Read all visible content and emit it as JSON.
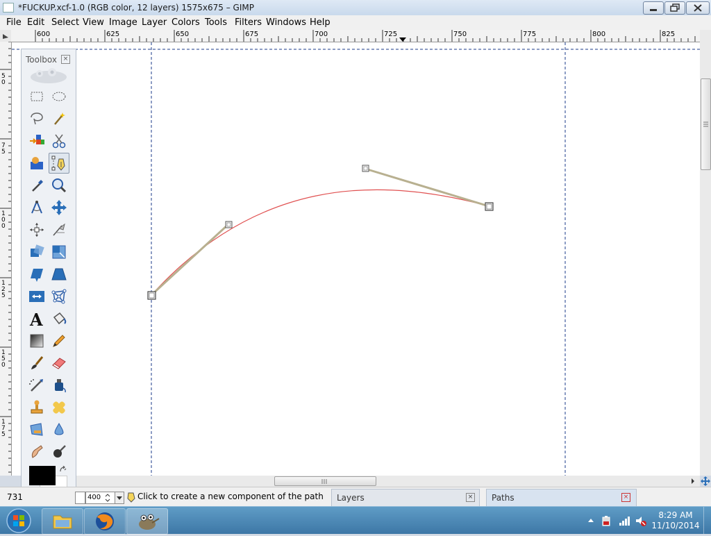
{
  "window": {
    "title": "*FUCKUP.xcf-1.0 (RGB color, 12 layers) 1575x675 – GIMP"
  },
  "menu": [
    "File",
    "Edit",
    "Select",
    "View",
    "Image",
    "Layer",
    "Colors",
    "Tools",
    "Filters",
    "Windows",
    "Help"
  ],
  "ruler": {
    "h_labels": [
      "600",
      "625",
      "650",
      "675",
      "700",
      "725",
      "750",
      "775",
      "800",
      "825"
    ],
    "v_labels": [
      "50",
      "75",
      "100",
      "125",
      "150",
      "175"
    ]
  },
  "toolbox": {
    "title": "Toolbox",
    "tools": [
      "rect-select",
      "ellipse-select",
      "free-select",
      "fuzzy-select",
      "select-by-color",
      "scissors-select",
      "foreground-select",
      "paths",
      "color-picker",
      "zoom",
      "measure",
      "move",
      "align",
      "crop",
      "rotate",
      "scale",
      "shear",
      "perspective",
      "flip",
      "cage-transform",
      "text",
      "bucket-fill",
      "blend",
      "pencil",
      "paintbrush",
      "eraser",
      "airbrush",
      "ink",
      "clone",
      "heal",
      "perspective-clone",
      "blur",
      "smudge",
      "dodge-burn"
    ],
    "active_tool": "paths"
  },
  "status": {
    "coord": "731",
    "zoom": "400",
    "message": "Click to create a new component of the path"
  },
  "docks": {
    "layers_tab": "Layers",
    "paths_tab": "Paths"
  },
  "taskbar": {
    "time": "8:29 AM",
    "date": "11/10/2014"
  },
  "colors": {
    "path_stroke": "#e05050",
    "handle": "#b8b090",
    "guide": "#1a3a8a"
  }
}
